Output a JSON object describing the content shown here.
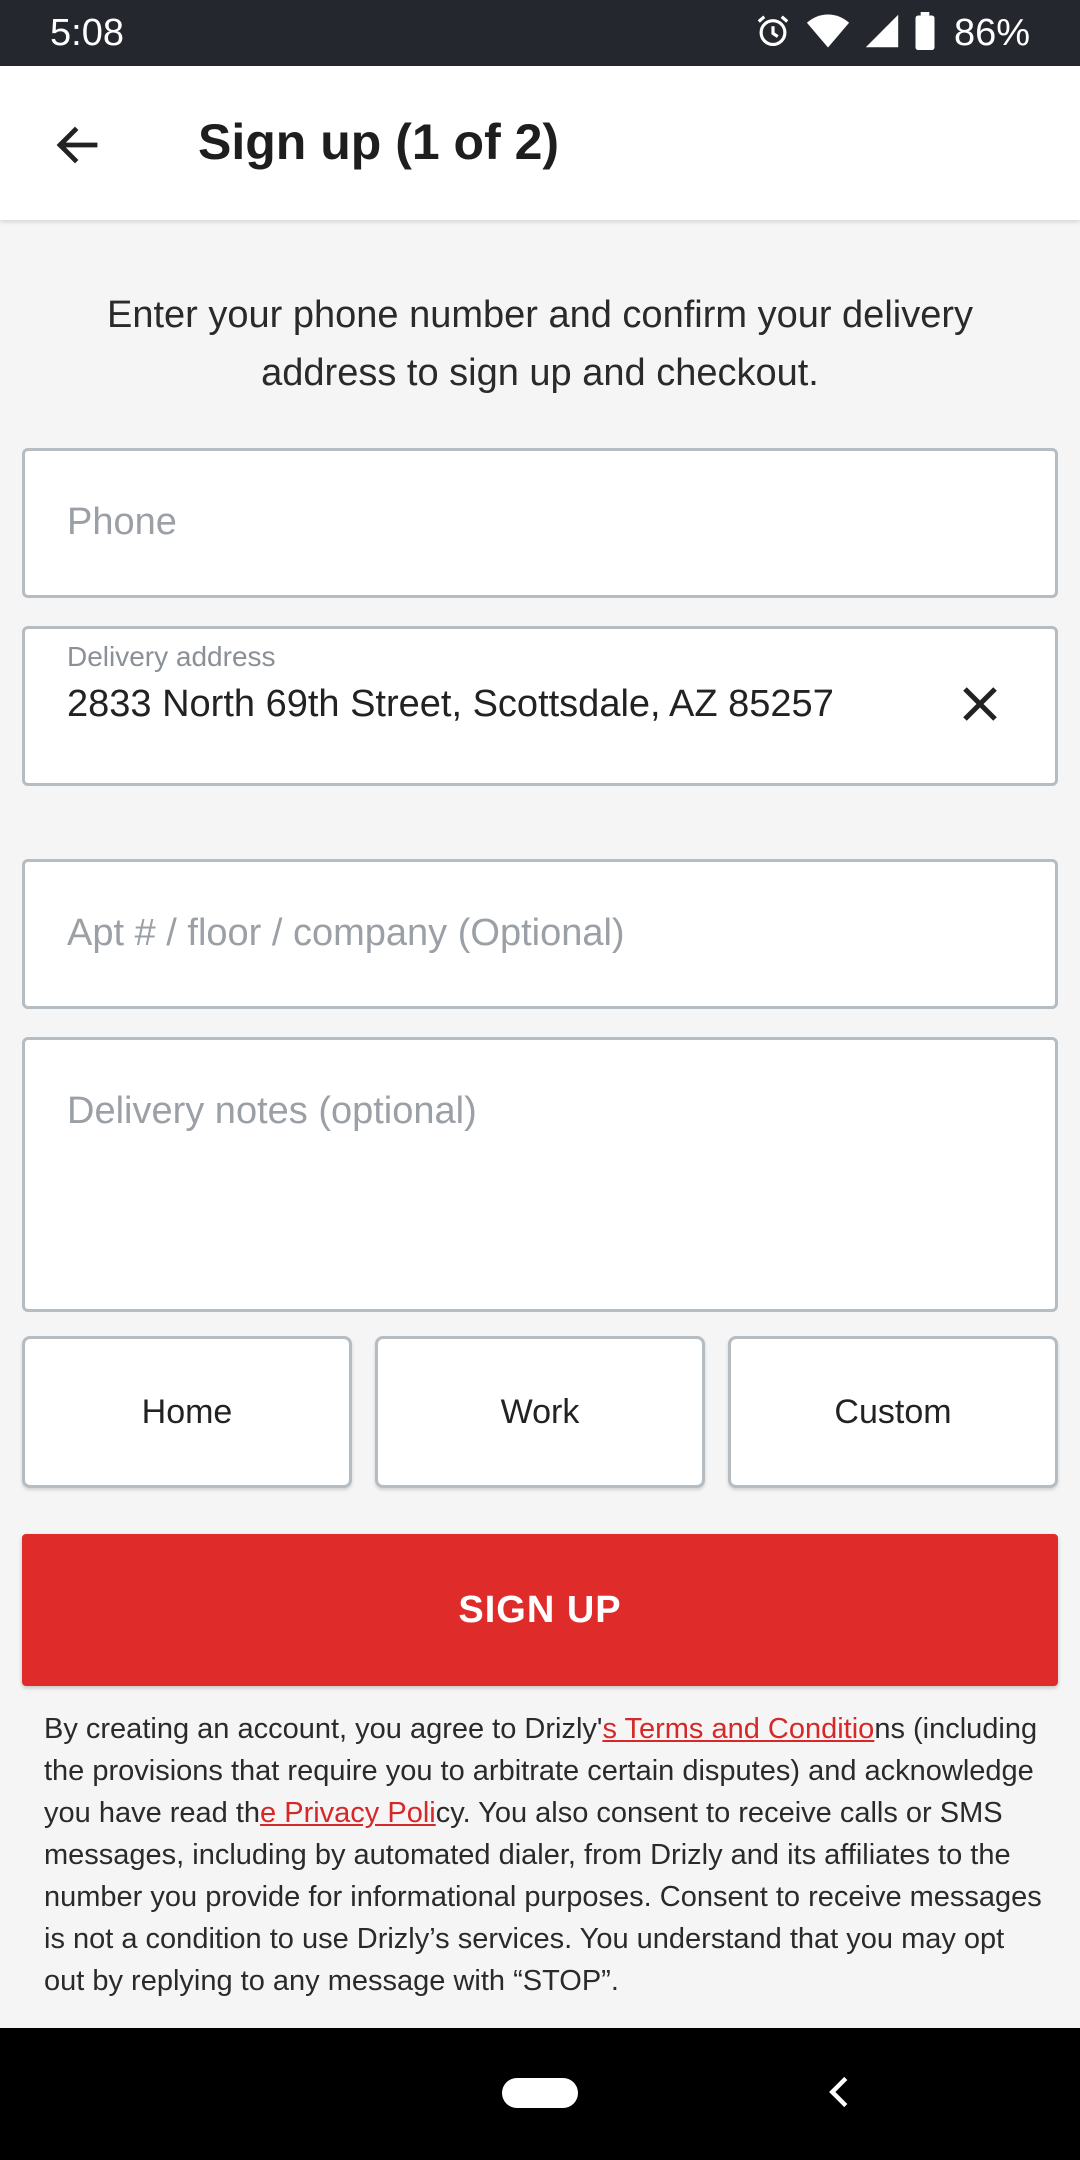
{
  "status_bar": {
    "time": "5:08",
    "battery_percent": "86%",
    "icons": [
      "alarm-icon",
      "wifi-icon",
      "signal-icon",
      "battery-icon"
    ]
  },
  "header": {
    "title": "Sign up (1 of 2)",
    "back_icon": "arrow-left-icon"
  },
  "intro_text": "Enter your phone number and confirm your delivery address to sign up and checkout.",
  "form": {
    "phone": {
      "placeholder": "Phone",
      "value": ""
    },
    "address": {
      "label": "Delivery address",
      "value": "2833 North 69th Street, Scottsdale, AZ 85257",
      "clear_icon": "close-icon"
    },
    "apt": {
      "placeholder": "Apt # / floor / company (Optional)",
      "value": ""
    },
    "notes": {
      "placeholder": "Delivery notes (optional)",
      "value": ""
    },
    "address_types": [
      "Home",
      "Work",
      "Custom"
    ]
  },
  "signup_button": "SIGN UP",
  "legal": {
    "p1": "By creating an account, you agree to Drizly'",
    "terms_link": "s Terms and Conditio",
    "p2": "ns (including the provisions that require you to arbitrate certain disputes) and acknowledge you have read th",
    "privacy_link": "e Privacy Poli",
    "p3": "cy. You also consent to receive calls or SMS messages, including by automated dialer, from Drizly and its affiliates to the number you provide for informational purposes. Consent to receive messages is not a condition to use Drizly’s services. You understand that you may opt out by replying to any message with “STOP”."
  },
  "colors": {
    "accent": "#e02b2b",
    "status_bar": "#24272e",
    "border": "#b5bcc2"
  }
}
